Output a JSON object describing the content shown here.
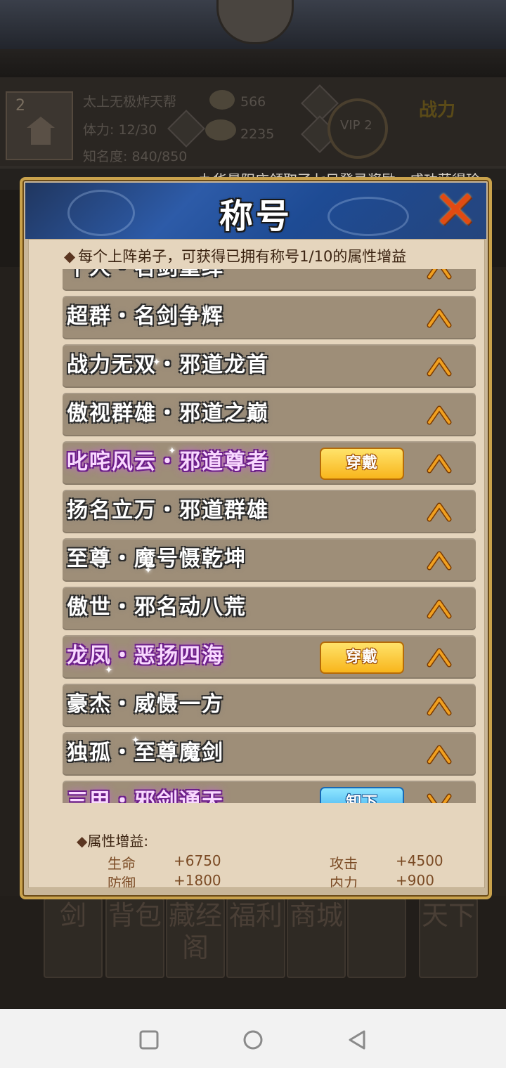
{
  "background": {
    "level": "2",
    "sect_name": "太上无极炸天帮",
    "stamina": "体力: 12/30",
    "fame": "知名度: 840/850",
    "silver": "566",
    "gold": "2235",
    "vip": "VIP 2",
    "power_label": "战力",
    "bottom_buttons": [
      "剑",
      "背包",
      "藏经阁",
      "福利",
      "商城",
      "",
      "天下"
    ]
  },
  "announcement": "九华景阳庄领取了七日登录奖励，成功获得珍",
  "dialog": {
    "title": "称号",
    "notice": "每个上阵弟子，可获得已拥有称号1/10的属性增益",
    "titles": [
      {
        "text": "千人・名剑重绎",
        "style": "silver",
        "action": "",
        "chevron": "up"
      },
      {
        "text": "超群・名剑争辉",
        "style": "silver",
        "action": "",
        "chevron": "up"
      },
      {
        "text": "战力无双・邪道龙首",
        "style": "silver",
        "action": "",
        "chevron": "up"
      },
      {
        "text": "傲视群雄・邪道之巅",
        "style": "silver",
        "action": "",
        "chevron": "up"
      },
      {
        "text": "叱咤风云・邪道尊者",
        "style": "purple",
        "action": "穿戴",
        "chevron": "up"
      },
      {
        "text": "扬名立万・邪道群雄",
        "style": "silver",
        "action": "",
        "chevron": "up"
      },
      {
        "text": "至尊・魔号慑乾坤",
        "style": "silver",
        "action": "",
        "chevron": "up"
      },
      {
        "text": "傲世・邪名动八荒",
        "style": "silver",
        "action": "",
        "chevron": "up"
      },
      {
        "text": "龙凤・恶扬四海",
        "style": "purple",
        "action": "穿戴",
        "chevron": "up"
      },
      {
        "text": "豪杰・威慑一方",
        "style": "silver",
        "action": "",
        "chevron": "up"
      },
      {
        "text": "独孤・至尊魔剑",
        "style": "silver",
        "action": "",
        "chevron": "up"
      },
      {
        "text": "三甲・邪剑通天",
        "style": "purple",
        "action": "卸下",
        "chevron": "down"
      }
    ],
    "attributes": {
      "heading": "属性增益:",
      "items": [
        {
          "label": "生命",
          "value": "+6750"
        },
        {
          "label": "攻击",
          "value": "+4500"
        },
        {
          "label": "防御",
          "value": "+1800"
        },
        {
          "label": "内力",
          "value": "+900"
        }
      ]
    }
  },
  "colors": {
    "accent_gold": "#f8b51c",
    "accent_blue": "#38a8ec",
    "row_bg": "#9e8e78",
    "chevron": "#f0a020"
  },
  "icons": {
    "close": "close-x-icon",
    "expand": "chevron-up-icon",
    "collapse": "chevron-down-icon"
  }
}
